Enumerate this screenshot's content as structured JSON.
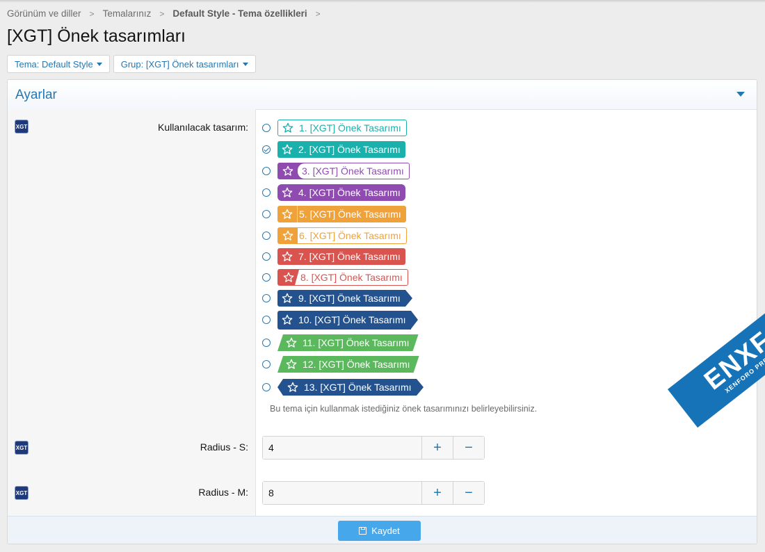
{
  "breadcrumb": {
    "items": [
      "Görünüm ve diller",
      "Temalarınız",
      "Default Style - Tema özellikleri"
    ],
    "separator": ">"
  },
  "page": {
    "title": "[XGT] Önek tasarımları"
  },
  "filters": {
    "style": "Tema: Default Style",
    "group": "Grup: [XGT] Önek tasarımları"
  },
  "panel": {
    "header": "Ayarlar",
    "prefix": {
      "label": "Kullanılacak tasarım:",
      "selected_index": 1,
      "options": [
        "1. [XGT] Önek Tasarımı",
        "2. [XGT] Önek Tasarımı",
        "3. [XGT] Önek Tasarımı",
        "4. [XGT] Önek Tasarımı",
        "5. [XGT] Önek Tasarımı",
        "6. [XGT] Önek Tasarımı",
        "7. [XGT] Önek Tasarımı",
        "8. [XGT] Önek Tasarımı",
        "9. [XGT] Önek Tasarımı",
        "10. [XGT] Önek Tasarımı",
        "11. [XGT] Önek Tasarımı",
        "12. [XGT] Önek Tasarımı",
        "13. [XGT] Önek Tasarımı"
      ],
      "hint": "Bu tema için kullanmak istediğiniz önek tasarımınızı belirleyebilirsiniz."
    },
    "radius_s": {
      "label": "Radius - S:",
      "value": "4"
    },
    "radius_m": {
      "label": "Radius - M:",
      "value": "8"
    },
    "xgt_badge": "XGT",
    "save": "Kaydet"
  },
  "watermark": {
    "main": "ENXF.NET",
    "sub": "XENFORO PREMIUM COMMUNITY"
  },
  "colors": {
    "accent": "#2577b1",
    "teal": "#1ab0ac",
    "purple": "#8f4bb0",
    "orange": "#efa23a",
    "red": "#d9534f",
    "navy": "#23528e",
    "green": "#5cb85c"
  }
}
